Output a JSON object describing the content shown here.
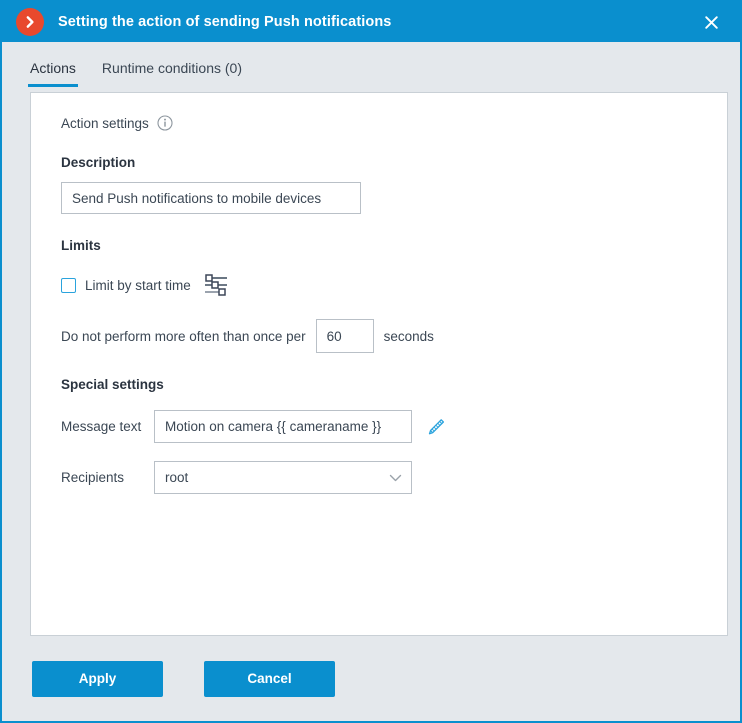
{
  "window": {
    "title": "Setting the action of sending Push notifications",
    "logo_icon": "chevron-right-circle-icon",
    "close_icon": "close-icon",
    "accent_color": "#0a8fce",
    "logo_color": "#e8492d",
    "background_color": "#e4e8ec"
  },
  "tabs": [
    {
      "label": "Actions",
      "active": true
    },
    {
      "label": "Runtime conditions (0)",
      "active": false
    }
  ],
  "action_settings": {
    "heading": "Action settings",
    "info_icon": "info-icon"
  },
  "description": {
    "label": "Description",
    "value": "Send Push notifications to mobile devices",
    "placeholder": "Description"
  },
  "limits": {
    "heading": "Limits",
    "limit_by_start_time": {
      "label": "Limit by start time",
      "checked": false,
      "icon": "sliders-icon"
    },
    "frequency": {
      "prefix": "Do not perform more often than once per",
      "value": "60",
      "suffix": "seconds"
    }
  },
  "special_settings": {
    "heading": "Special settings",
    "message_text": {
      "label": "Message text",
      "value": "Motion on camera {{ cameraname }}",
      "placeholder": "Message text",
      "edit_icon": "pencil-icon"
    },
    "recipients": {
      "label": "Recipients",
      "value": "root",
      "chevron_icon": "chevron-down-icon"
    }
  },
  "footer": {
    "apply_label": "Apply",
    "cancel_label": "Cancel"
  }
}
